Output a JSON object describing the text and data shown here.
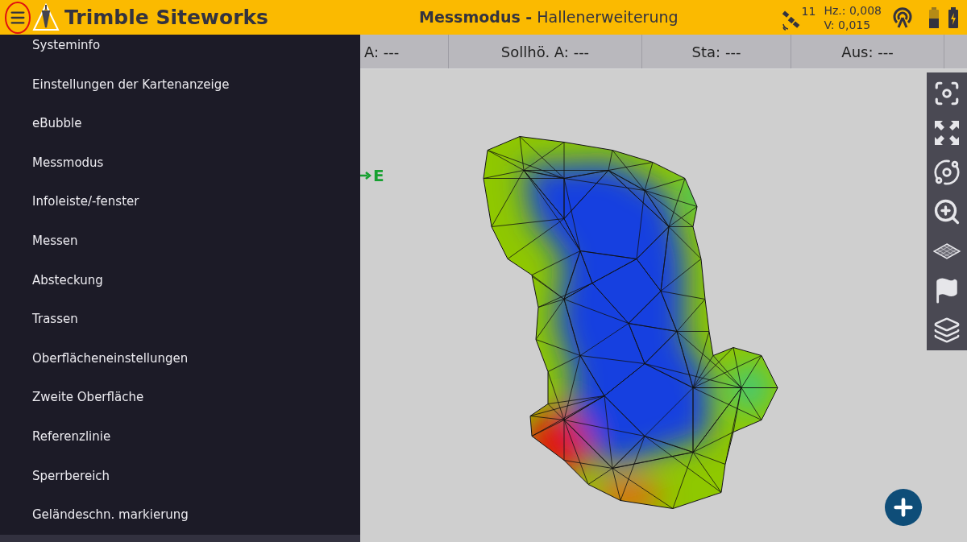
{
  "header": {
    "title": "Trimble Siteworks",
    "mode": "Messmodus -",
    "project": "Hallenerweiterung",
    "satellites": "11",
    "hz": "Hz.: 0,008",
    "v": "V: 0,015"
  },
  "menu": {
    "items": [
      "Systeminfo",
      "Einstellungen der Kartenanzeige",
      "eBubble",
      "Messmodus",
      "Infoleiste/-fenster",
      "Messen",
      "Absteckung",
      "Trassen",
      "Oberflächeneinstellungen",
      "Zweite Oberfläche",
      "Referenzlinie",
      "Sperrbereich",
      "Geländeschn. markierung"
    ]
  },
  "info_bar": {
    "cells": [
      "A: ---",
      "Sollhö. A: ---",
      "Sta: ---",
      "Aus: ---"
    ]
  },
  "map": {
    "marker": "E"
  }
}
